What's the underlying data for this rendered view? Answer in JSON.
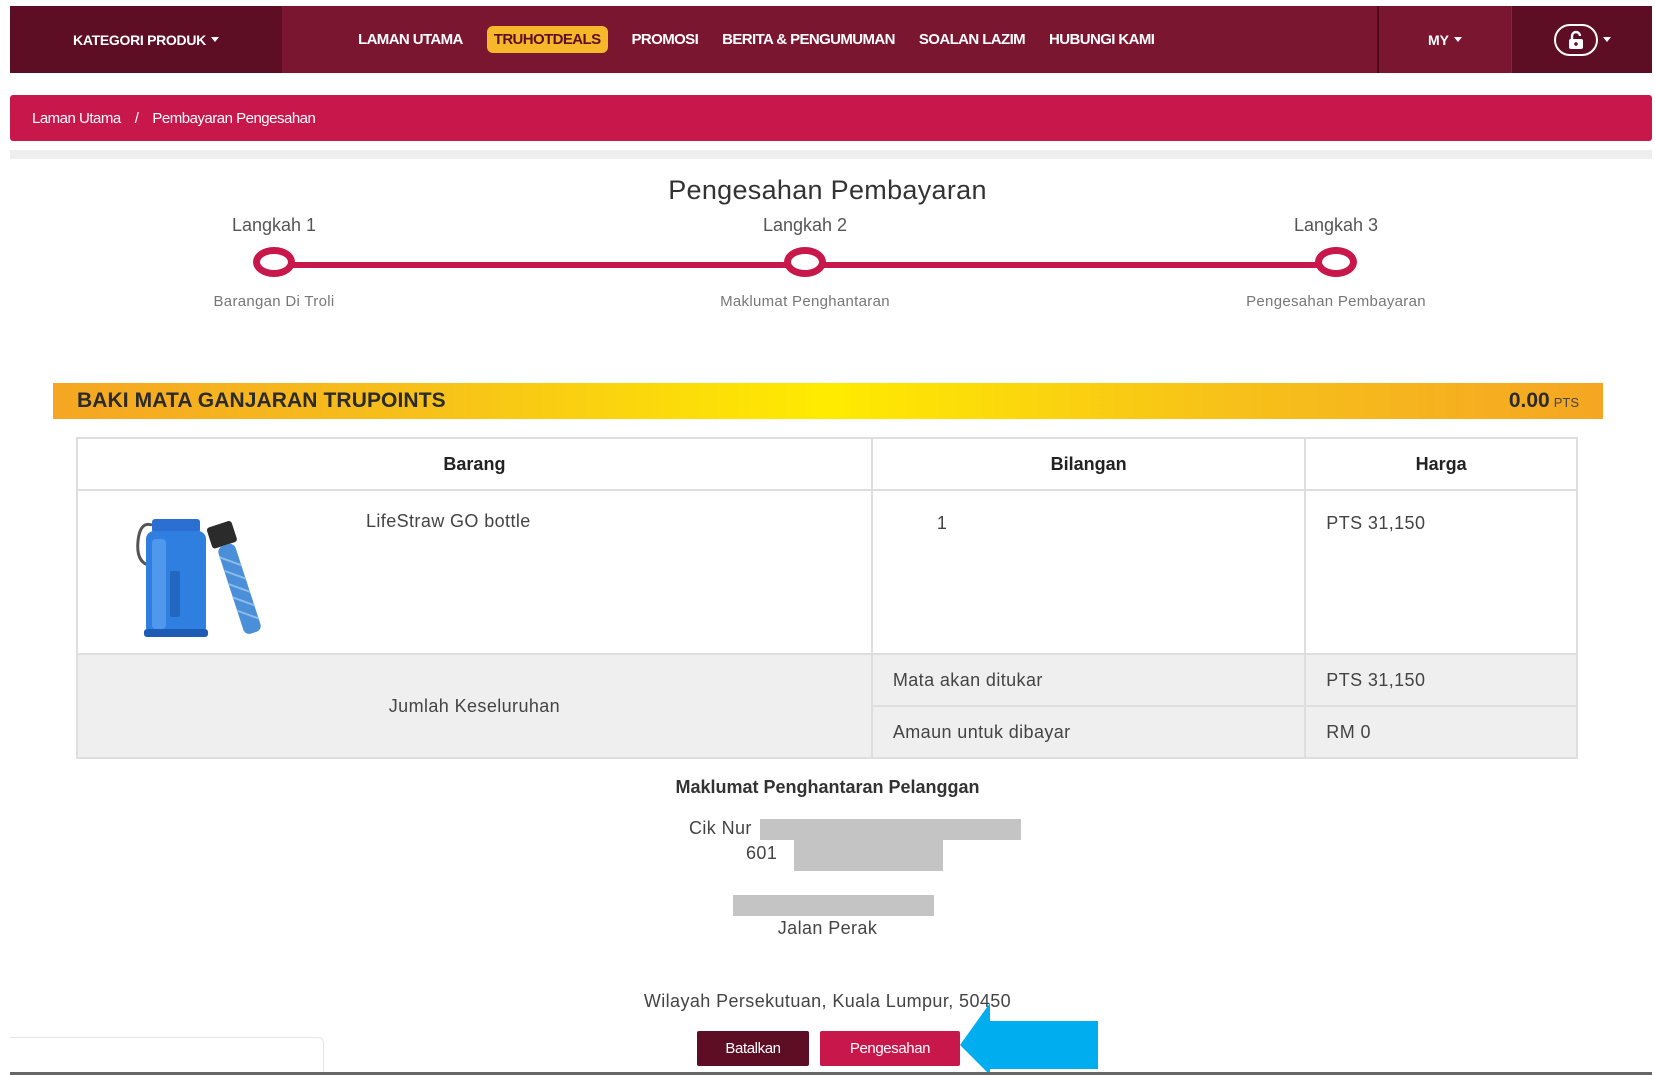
{
  "nav": {
    "category": "KATEGORI PRODUK",
    "items": [
      {
        "label": "LAMAN UTAMA"
      },
      {
        "label": "TRUHOTDEALS"
      },
      {
        "label": "PROMOSI"
      },
      {
        "label": "BERITA & PENGUMUMAN"
      },
      {
        "label": "SOALAN LAZIM"
      },
      {
        "label": "HUBUNGI KAMI"
      }
    ],
    "language": "MY",
    "account_icon": "lock-icon",
    "colors": {
      "primary": "#7b1630",
      "dark": "#5e0e24",
      "accent": "#c8174b",
      "highlight": "#f6b72a"
    }
  },
  "breadcrumb": {
    "home": "Laman Utama",
    "separator": "/",
    "current": "Pembayaran Pengesahan"
  },
  "page": {
    "title": "Pengesahan Pembayaran"
  },
  "stepper": {
    "steps": [
      {
        "label": "Langkah 1",
        "desc": "Barangan Di Troli"
      },
      {
        "label": "Langkah 2",
        "desc": "Maklumat Penghantaran"
      },
      {
        "label": "Langkah 3",
        "desc": "Pengesahan Pembayaran"
      }
    ]
  },
  "points": {
    "title": "BAKI MATA GANJARAN TRUPOINTS",
    "value": "0.00",
    "unit": "PTS"
  },
  "table": {
    "headers": {
      "item": "Barang",
      "qty": "Bilangan",
      "price": "Harga"
    },
    "rows": [
      {
        "name": "LifeStraw GO bottle",
        "qty": "1",
        "price": "PTS 31,150",
        "image_icon": "water-bottle-image"
      }
    ],
    "summary": {
      "label": "Jumlah Keseluruhan",
      "points_label": "Mata akan ditukar",
      "points_value": "PTS 31,150",
      "pay_label": "Amaun untuk dibayar",
      "pay_value": "RM 0"
    }
  },
  "delivery": {
    "title": "Maklumat Penghantaran Pelanggan",
    "name_prefix": "Cik Nur",
    "phone_prefix": "601",
    "address_line_2": "Jalan Perak",
    "address_line_3": "Wilayah Persekutuan, Kuala Lumpur, 50450"
  },
  "buttons": {
    "cancel": "Batalkan",
    "confirm": "Pengesahan"
  }
}
